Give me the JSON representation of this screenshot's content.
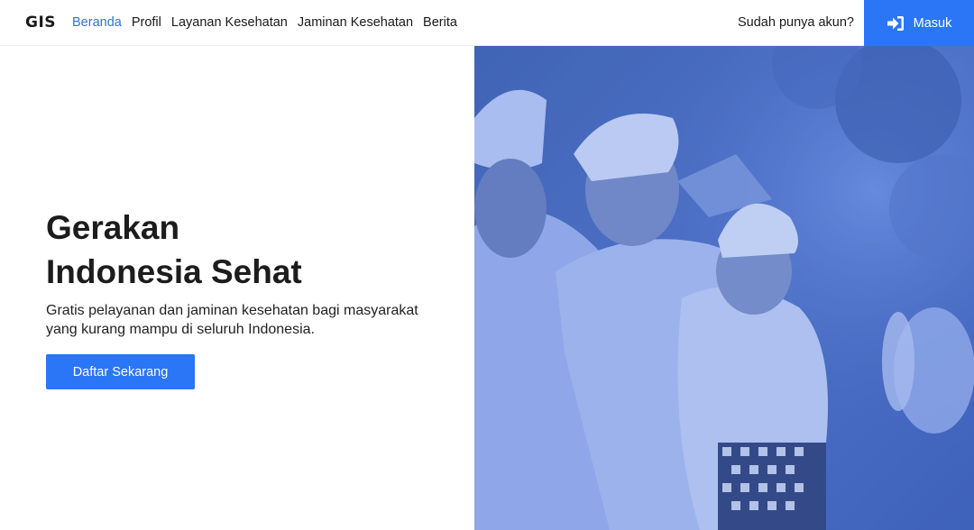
{
  "brand": {
    "logo_text": "GIS"
  },
  "nav": {
    "links": [
      {
        "label": "Beranda",
        "active": true
      },
      {
        "label": "Profil",
        "active": false
      },
      {
        "label": "Layanan Kesehatan",
        "active": false
      },
      {
        "label": "Jaminan Kesehatan",
        "active": false
      },
      {
        "label": "Berita",
        "active": false
      }
    ],
    "account_prompt": "Sudah punya akun?",
    "login_label": "Masuk",
    "login_icon": "sign-in-icon"
  },
  "hero": {
    "title_line1": "Gerakan",
    "title_line2": "Indonesia Sehat",
    "description": "Gratis pelayanan dan jaminan kesehatan bagi masyarakat yang kurang mampu di seluruh Indonesia.",
    "cta_label": "Daftar Sekarang"
  },
  "colors": {
    "accent": "#2a76f6",
    "active_link": "#2f73d9",
    "image_tint": "#4d74d6"
  }
}
